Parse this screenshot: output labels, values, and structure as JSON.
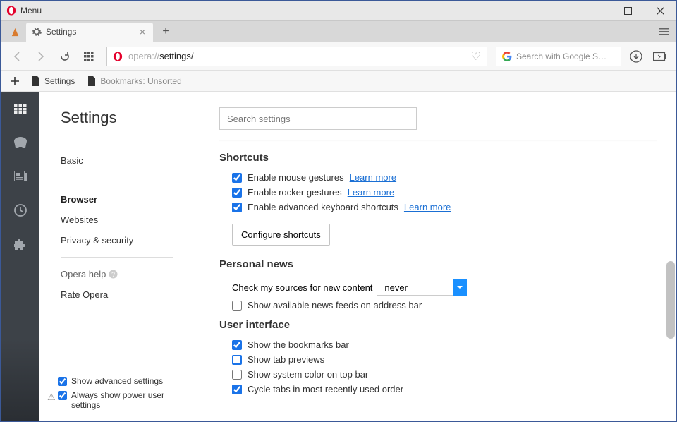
{
  "titlebar": {
    "title": "Menu"
  },
  "tab": {
    "title": "Settings"
  },
  "url": {
    "prefix": "opera://",
    "path": "settings/"
  },
  "search": {
    "placeholder": "Search with Google S…"
  },
  "bookmarksbar": {
    "settings": "Settings",
    "unsorted": "Bookmarks: Unsorted"
  },
  "sidenav": {
    "title": "Settings",
    "basic": "Basic",
    "browser": "Browser",
    "websites": "Websites",
    "privacy": "Privacy & security",
    "help": "Opera help",
    "rate": "Rate Opera",
    "advanced": "Show advanced settings",
    "poweruser": "Always show power user settings"
  },
  "settings_search": {
    "placeholder": "Search settings"
  },
  "shortcuts": {
    "heading": "Shortcuts",
    "mouse": "Enable mouse gestures",
    "rocker": "Enable rocker gestures",
    "keyboard": "Enable advanced keyboard shortcuts",
    "learn": "Learn more",
    "configure": "Configure shortcuts"
  },
  "news": {
    "heading": "Personal news",
    "check": "Check my sources for new content",
    "never": "never",
    "feeds": "Show available news feeds on address bar"
  },
  "ui": {
    "heading": "User interface",
    "bookmarks": "Show the bookmarks bar",
    "tabpreviews": "Show tab previews",
    "syscolor": "Show system color on top bar",
    "cycle": "Cycle tabs in most recently used order"
  }
}
